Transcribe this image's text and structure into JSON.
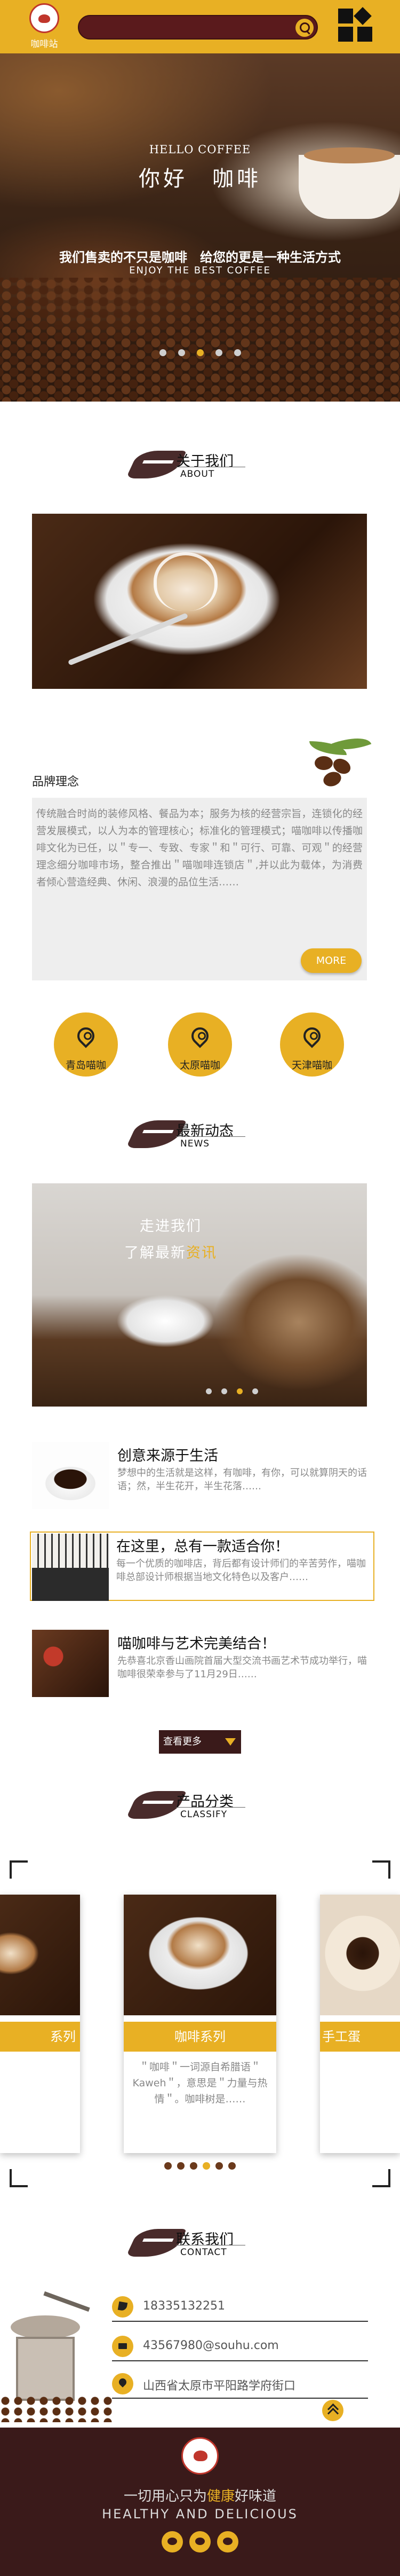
{
  "header": {
    "brand_name": "咖啡站",
    "search_placeholder": "",
    "accent_color": "#e8b024",
    "dark_color": "#3a1a1a",
    "icons": [
      "logo-icon",
      "search-icon",
      "grid-menu-icon"
    ]
  },
  "banner": {
    "hello": "HELLO COFFEE",
    "nihao": "你好　咖啡",
    "slogan": "我们售卖的不只是咖啡　给您的更是一种生活方式",
    "enjoy": "ENJOY THE BEST COFFEE",
    "slide_count": 5,
    "active_slide": 3
  },
  "about": {
    "title_zh": "关于我们",
    "title_en": "ABOUT",
    "brand_title": "品牌理念",
    "brand_text": "传统融合时尚的装修风格、餐品为本；服务为核的经营宗旨，连锁化的经营发展模式，以人为本的管理核心；标准化的管理模式；喵咖啡以传播咖啡文化为已任，以＂专一、专致、专家＂和＂可行、可靠、可观＂的经营理念细分咖啡市场，整合推出＂喵咖啡连锁店＂,并以此为载体，为消费者倾心营造经典、休闲、浪漫的品位生活……",
    "more_label": "MORE"
  },
  "locations": [
    {
      "label": "青岛喵咖"
    },
    {
      "label": "太原喵咖"
    },
    {
      "label": "天津喵咖"
    }
  ],
  "news": {
    "title_zh": "最新动态",
    "title_en": "NEWS",
    "banner_line1": "走进我们",
    "banner_line2_a": "了解最新",
    "banner_line2_b": "资讯",
    "slide_count": 4,
    "active_slide": 3,
    "items": [
      {
        "title": "创意来源于生活",
        "desc": "梦想中的生活就是这样，有咖啡，有你，可以就算阴天的话语；然，半生花开，半生花落……"
      },
      {
        "title": "在这里，总有一款适合你！",
        "desc": "每一个优质的咖啡店，背后都有设计师们的辛苦劳作，喵咖啡总部设计师根据当地文化特色以及客户……"
      },
      {
        "title": "喵咖啡与艺术完美结合！",
        "desc": "先恭喜北京香山画院首届大型交流书画艺术节成功举行，喵咖啡很荣幸参与了11月29日……"
      }
    ],
    "more_label": "查看更多"
  },
  "classify": {
    "title_zh": "产品分类",
    "title_en": "CLASSIFY",
    "left_label": "系列",
    "center_label": "咖啡系列",
    "center_text": "＂咖啡＂一词源自希腊语＂Kaweh＂，意思是＂力量与热情＂。咖啡树是……",
    "right_label": "手工蛋",
    "dot_count": 6,
    "active_dot": 4
  },
  "contact": {
    "title_zh": "联系我们",
    "title_en": "CONTACT",
    "phone": "18335132251",
    "email": "43567980@souhu.com",
    "address": "山西省太原市平阳路学府街口"
  },
  "footer": {
    "slogan_a": "一切用心只为",
    "slogan_b": "健康",
    "slogan_c": "好味道",
    "en": "HEALTHY  AND  DELICIOUS",
    "social_icons": [
      "weibo-icon",
      "wechat-icon",
      "qq-icon"
    ]
  }
}
